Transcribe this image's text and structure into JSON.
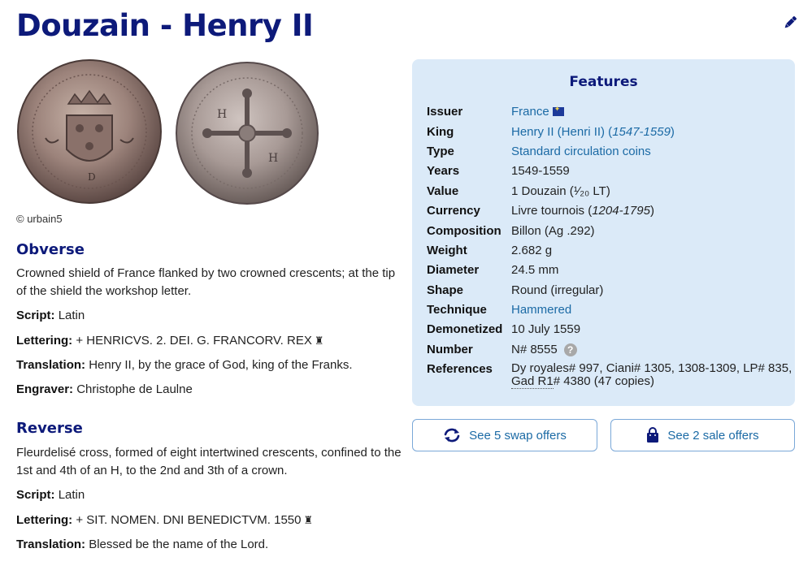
{
  "page": {
    "title": "Douzain - Henry II"
  },
  "images": {
    "photo_credit": "© urbain5"
  },
  "obverse": {
    "title": "Obverse",
    "description": "Crowned shield of France flanked by two crowned crescents; at the tip of the shield the workshop letter.",
    "script_label": "Script:",
    "script": "Latin",
    "lettering_label": "Lettering:",
    "lettering": "+ HENRICVS. 2. DEI. G. FRANCORV. REX",
    "translation_label": "Translation:",
    "translation": "Henry II, by the grace of God, king of the Franks.",
    "engraver_label": "Engraver:",
    "engraver": "Christophe de Laulne"
  },
  "reverse": {
    "title": "Reverse",
    "description": "Fleurdelisé cross, formed of eight intertwined crescents, confined to the 1st and 4th of an H, to the 2nd and 3th of a crown.",
    "script_label": "Script:",
    "script": "Latin",
    "lettering_label": "Lettering:",
    "lettering": "+ SIT. NOMEN. DNI BENEDICTVM. 1550",
    "translation_label": "Translation:",
    "translation": "Blessed be the name of the Lord."
  },
  "features": {
    "title": "Features",
    "issuer_label": "Issuer",
    "issuer": "France",
    "king_label": "King",
    "king": "Henry II (Henri II) (",
    "king_years": "1547-1559",
    "king_close": ")",
    "type_label": "Type",
    "type": "Standard circulation coins",
    "years_label": "Years",
    "years": "1549-1559",
    "value_label": "Value",
    "value": "1 Douzain (¹⁄₂₀ LT)",
    "currency_label": "Currency",
    "currency": "Livre tournois (",
    "currency_years": "1204-1795",
    "currency_close": ")",
    "composition_label": "Composition",
    "composition": "Billon (Ag .292)",
    "weight_label": "Weight",
    "weight": "2.682 g",
    "diameter_label": "Diameter",
    "diameter": "24.5 mm",
    "shape_label": "Shape",
    "shape": "Round (irregular)",
    "technique_label": "Technique",
    "technique": "Hammered",
    "demonetized_label": "Demonetized",
    "demonetized": "10 July 1559",
    "number_label": "Number",
    "number": "N# 8555",
    "references_label": "References",
    "references_line1": "Dy royales# 997, Ciani# 1305, 1308-1309, LP# 835,",
    "references_line2_a": "Gad R1",
    "references_line2_b": "# 4380 (47 copies)"
  },
  "actions": {
    "swap_label": "See 5 swap offers",
    "sale_label": "See 2 sale offers"
  },
  "colors": {
    "title": "#0d1a7a",
    "link": "#1b6aa5",
    "panel_bg": "#dbeaf8"
  }
}
